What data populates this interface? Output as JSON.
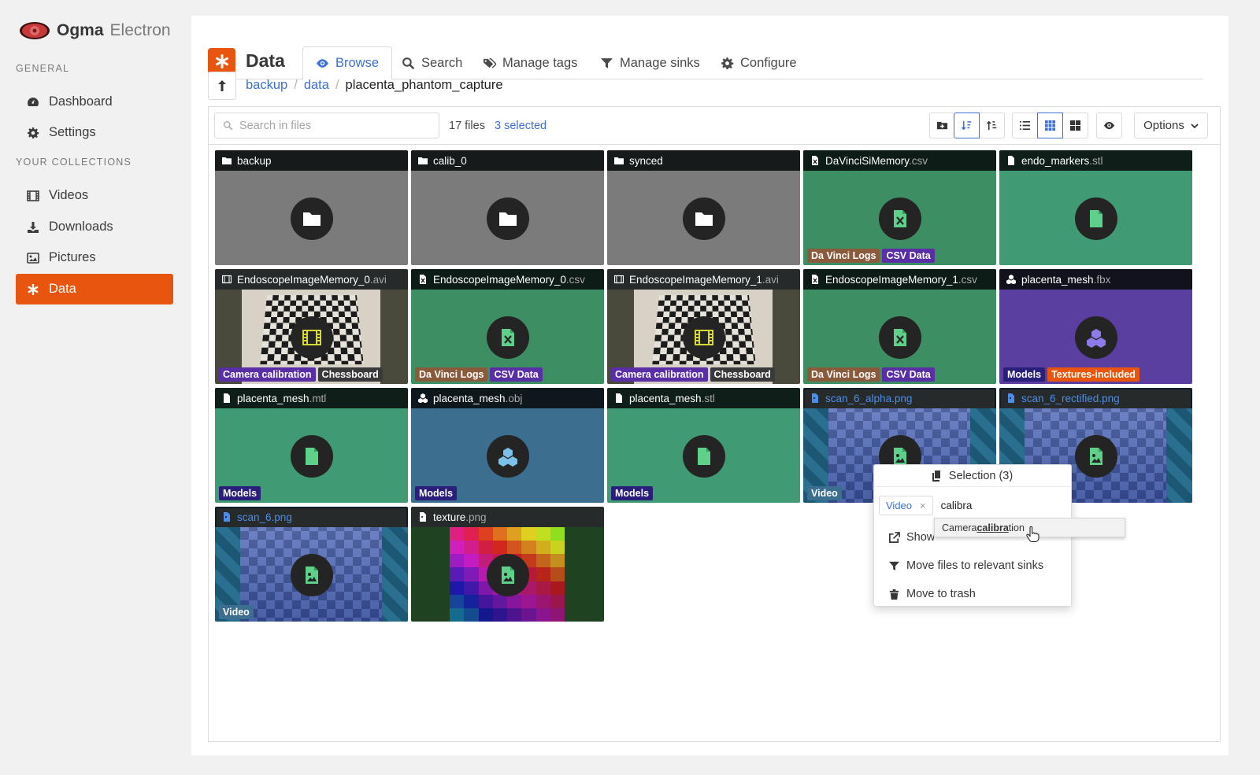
{
  "app": {
    "name_bold": "Ogma",
    "name_light": "Electron"
  },
  "sidebar": {
    "general_label": "GENERAL",
    "general_items": [
      {
        "label": "Dashboard",
        "icon": "gauge-icon"
      },
      {
        "label": "Settings",
        "icon": "gear-icon"
      }
    ],
    "collections_label": "YOUR COLLECTIONS",
    "collection_items": [
      {
        "label": "Videos",
        "icon": "film-icon"
      },
      {
        "label": "Downloads",
        "icon": "download-icon"
      },
      {
        "label": "Pictures",
        "icon": "image-icon"
      },
      {
        "label": "Data",
        "icon": "asterisk-icon",
        "active": true
      }
    ]
  },
  "page": {
    "title": "Data"
  },
  "tabs": [
    {
      "label": "Browse",
      "icon": "eye-icon",
      "active": true
    },
    {
      "label": "Search",
      "icon": "search-icon"
    },
    {
      "label": "Manage tags",
      "icon": "tags-icon"
    },
    {
      "label": "Manage sinks",
      "icon": "filter-icon"
    },
    {
      "label": "Configure",
      "icon": "gear-icon"
    }
  ],
  "breadcrumb": {
    "parts": [
      "backup",
      "data"
    ],
    "current": "placenta_phantom_capture"
  },
  "toolbar": {
    "search_placeholder": "Search in files",
    "file_count": "17 files",
    "selected_count": "3 selected",
    "options_label": "Options",
    "sort_mode": "ascending",
    "view_mode": "grid"
  },
  "files": [
    {
      "name": "backup",
      "ext": "",
      "kind": "folder",
      "tags": []
    },
    {
      "name": "calib_0",
      "ext": "",
      "kind": "folder",
      "tags": []
    },
    {
      "name": "synced",
      "ext": "",
      "kind": "folder",
      "tags": []
    },
    {
      "name": "DaVinciSiMemory",
      "ext": ".csv",
      "kind": "csv",
      "tags": [
        {
          "label": "Da Vinci Logs",
          "color": "#8a5a3c"
        },
        {
          "label": "CSV Data",
          "color": "#5a2fa6"
        }
      ]
    },
    {
      "name": "endo_markers",
      "ext": ".stl",
      "kind": "file",
      "tags": []
    },
    {
      "name": "EndoscopeImageMemory_0",
      "ext": ".avi",
      "kind": "video",
      "tags": [
        {
          "label": "Camera calibration",
          "color": "#5a2fa6"
        },
        {
          "label": "Chessboard",
          "color": "#3a3a3a"
        }
      ]
    },
    {
      "name": "EndoscopeImageMemory_0",
      "ext": ".csv",
      "kind": "csv",
      "tags": [
        {
          "label": "Da Vinci Logs",
          "color": "#8a5a3c"
        },
        {
          "label": "CSV Data",
          "color": "#5a2fa6"
        }
      ]
    },
    {
      "name": "EndoscopeImageMemory_1",
      "ext": ".avi",
      "kind": "video",
      "tags": [
        {
          "label": "Camera calibration",
          "color": "#5a2fa6"
        },
        {
          "label": "Chessboard",
          "color": "#3a3a3a"
        }
      ]
    },
    {
      "name": "EndoscopeImageMemory_1",
      "ext": ".csv",
      "kind": "csv",
      "tags": [
        {
          "label": "Da Vinci Logs",
          "color": "#8a5a3c"
        },
        {
          "label": "CSV Data",
          "color": "#5a2fa6"
        }
      ]
    },
    {
      "name": "placenta_mesh",
      "ext": ".fbx",
      "kind": "model-purple",
      "tags": [
        {
          "label": "Models",
          "color": "#2a1f7a"
        },
        {
          "label": "Textures-included",
          "color": "#e8550e"
        }
      ]
    },
    {
      "name": "placenta_mesh",
      "ext": ".mtl",
      "kind": "file",
      "tags": [
        {
          "label": "Models",
          "color": "#2a1f7a"
        }
      ]
    },
    {
      "name": "placenta_mesh",
      "ext": ".obj",
      "kind": "model-blue",
      "tags": [
        {
          "label": "Models",
          "color": "#2a1f7a"
        }
      ]
    },
    {
      "name": "placenta_mesh",
      "ext": ".stl",
      "kind": "file",
      "tags": [
        {
          "label": "Models",
          "color": "#2a1f7a"
        }
      ]
    },
    {
      "name": "scan_6_alpha",
      "ext": ".png",
      "kind": "scan",
      "selected": true,
      "tags": [
        {
          "label": "Video",
          "color": "#3c6e8f"
        }
      ]
    },
    {
      "name": "scan_6_rectified",
      "ext": ".png",
      "kind": "scan",
      "selected": true,
      "tags": []
    },
    {
      "name": "scan_6",
      "ext": ".png",
      "kind": "scan",
      "selected": true,
      "tags": [
        {
          "label": "Video",
          "color": "#3c6e8f"
        }
      ]
    },
    {
      "name": "texture",
      "ext": ".png",
      "kind": "texture",
      "tags": []
    }
  ],
  "selection_popup": {
    "title": "Selection (3)",
    "chip_label": "Video",
    "chip_remove": "×",
    "typed_text": "calibra",
    "actions": [
      {
        "label": "Show",
        "icon": "external-link-icon"
      },
      {
        "label": "Move files to relevant sinks",
        "icon": "filter-icon"
      },
      {
        "label": "Move to trash",
        "icon": "trash-icon"
      }
    ]
  },
  "suggestion": {
    "prefix": "Camera ",
    "match": "calibra",
    "suffix": "tion"
  },
  "colors": {
    "accent": "#e8550e",
    "link": "#3e70d1",
    "selected": "#4b8de8"
  }
}
